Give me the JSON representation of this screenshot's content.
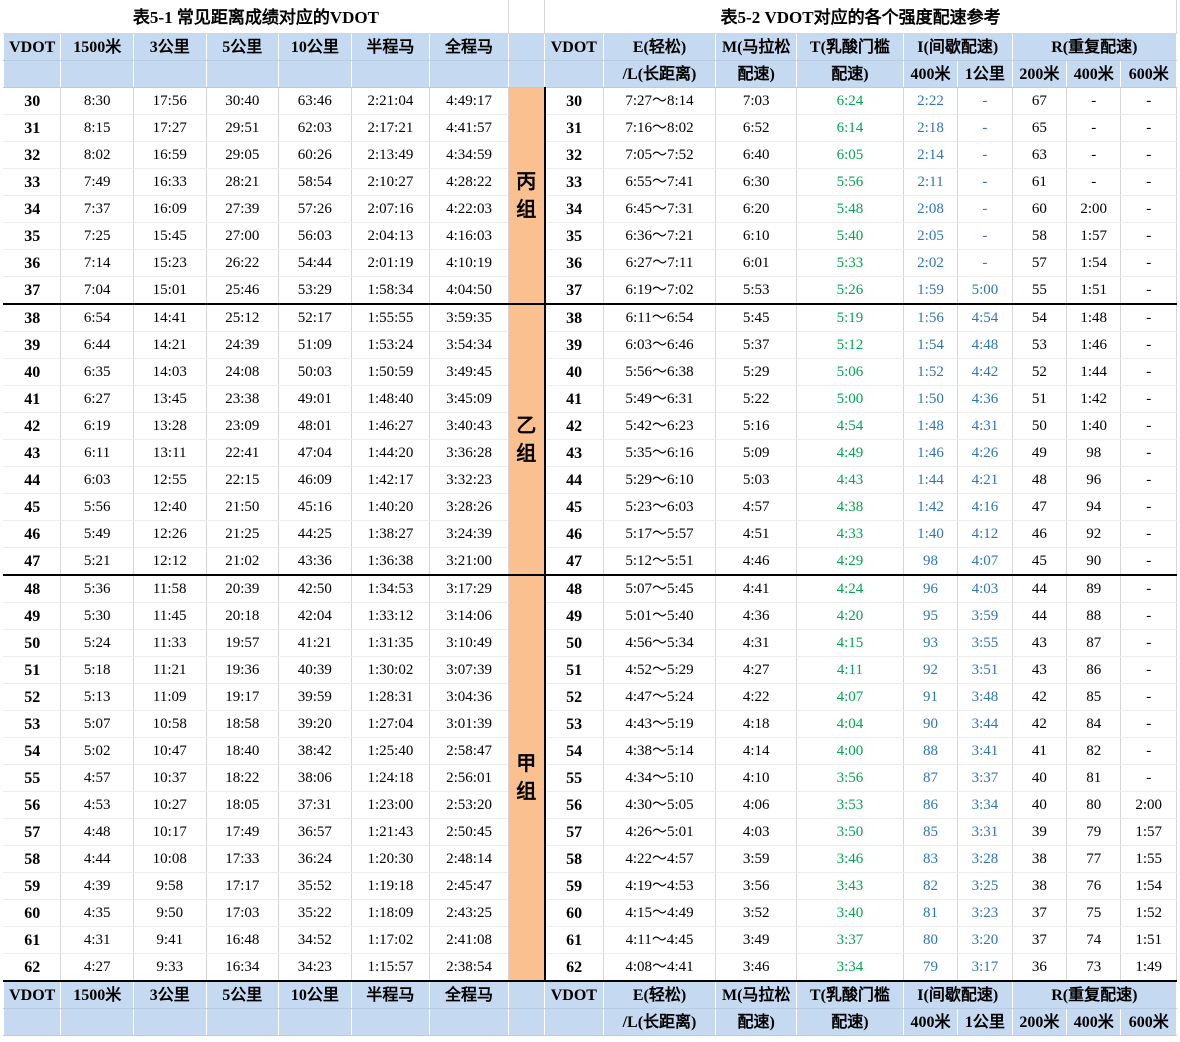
{
  "titles": {
    "left": "表5-1  常见距离成绩对应的VDOT",
    "right": "表5-2  VDOT对应的各个强度配速参考"
  },
  "headers": {
    "left": [
      "VDOT",
      "1500米",
      "3公里",
      "5公里",
      "10公里",
      "半程马",
      "全程马"
    ],
    "right_top": [
      "VDOT",
      "E(轻松)",
      "M(马拉松",
      "T(乳酸门槛",
      "I(间歇配速)",
      "R(重复配速)"
    ],
    "right_bottom": [
      "/L(长距离)",
      "配速)",
      "配速)",
      "400米",
      "1公里",
      "200米",
      "400米",
      "600米"
    ]
  },
  "groups": [
    {
      "label": "丙组",
      "rows": 8
    },
    {
      "label": "乙组",
      "rows": 10
    },
    {
      "label": "甲组",
      "rows": 15
    }
  ],
  "rows": [
    [
      "30",
      "8:30",
      "17:56",
      "30:40",
      "63:46",
      "2:21:04",
      "4:49:17",
      "30",
      "7:27～8:14",
      "7:03",
      "6:24",
      "2:22",
      "-",
      "67",
      "-",
      "-"
    ],
    [
      "31",
      "8:15",
      "17:27",
      "29:51",
      "62:03",
      "2:17:21",
      "4:41:57",
      "31",
      "7:16～8:02",
      "6:52",
      "6:14",
      "2:18",
      "-",
      "65",
      "-",
      "-"
    ],
    [
      "32",
      "8:02",
      "16:59",
      "29:05",
      "60:26",
      "2:13:49",
      "4:34:59",
      "32",
      "7:05～7:52",
      "6:40",
      "6:05",
      "2:14",
      "-",
      "63",
      "-",
      "-"
    ],
    [
      "33",
      "7:49",
      "16:33",
      "28:21",
      "58:54",
      "2:10:27",
      "4:28:22",
      "33",
      "6:55～7:41",
      "6:30",
      "5:56",
      "2:11",
      "-",
      "61",
      "-",
      "-"
    ],
    [
      "34",
      "7:37",
      "16:09",
      "27:39",
      "57:26",
      "2:07:16",
      "4:22:03",
      "34",
      "6:45～7:31",
      "6:20",
      "5:48",
      "2:08",
      "-",
      "60",
      "2:00",
      "-"
    ],
    [
      "35",
      "7:25",
      "15:45",
      "27:00",
      "56:03",
      "2:04:13",
      "4:16:03",
      "35",
      "6:36～7:21",
      "6:10",
      "5:40",
      "2:05",
      "-",
      "58",
      "1:57",
      "-"
    ],
    [
      "36",
      "7:14",
      "15:23",
      "26:22",
      "54:44",
      "2:01:19",
      "4:10:19",
      "36",
      "6:27～7:11",
      "6:01",
      "5:33",
      "2:02",
      "-",
      "57",
      "1:54",
      "-"
    ],
    [
      "37",
      "7:04",
      "15:01",
      "25:46",
      "53:29",
      "1:58:34",
      "4:04:50",
      "37",
      "6:19～7:02",
      "5:53",
      "5:26",
      "1:59",
      "5:00",
      "55",
      "1:51",
      "-"
    ],
    [
      "38",
      "6:54",
      "14:41",
      "25:12",
      "52:17",
      "1:55:55",
      "3:59:35",
      "38",
      "6:11～6:54",
      "5:45",
      "5:19",
      "1:56",
      "4:54",
      "54",
      "1:48",
      "-"
    ],
    [
      "39",
      "6:44",
      "14:21",
      "24:39",
      "51:09",
      "1:53:24",
      "3:54:34",
      "39",
      "6:03～6:46",
      "5:37",
      "5:12",
      "1:54",
      "4:48",
      "53",
      "1:46",
      "-"
    ],
    [
      "40",
      "6:35",
      "14:03",
      "24:08",
      "50:03",
      "1:50:59",
      "3:49:45",
      "40",
      "5:56～6:38",
      "5:29",
      "5:06",
      "1:52",
      "4:42",
      "52",
      "1:44",
      "-"
    ],
    [
      "41",
      "6:27",
      "13:45",
      "23:38",
      "49:01",
      "1:48:40",
      "3:45:09",
      "41",
      "5:49～6:31",
      "5:22",
      "5:00",
      "1:50",
      "4:36",
      "51",
      "1:42",
      "-"
    ],
    [
      "42",
      "6:19",
      "13:28",
      "23:09",
      "48:01",
      "1:46:27",
      "3:40:43",
      "42",
      "5:42～6:23",
      "5:16",
      "4:54",
      "1:48",
      "4:31",
      "50",
      "1:40",
      "-"
    ],
    [
      "43",
      "6:11",
      "13:11",
      "22:41",
      "47:04",
      "1:44:20",
      "3:36:28",
      "43",
      "5:35～6:16",
      "5:09",
      "4:49",
      "1:46",
      "4:26",
      "49",
      "98",
      "-"
    ],
    [
      "44",
      "6:03",
      "12:55",
      "22:15",
      "46:09",
      "1:42:17",
      "3:32:23",
      "44",
      "5:29～6:10",
      "5:03",
      "4:43",
      "1:44",
      "4:21",
      "48",
      "96",
      "-"
    ],
    [
      "45",
      "5:56",
      "12:40",
      "21:50",
      "45:16",
      "1:40:20",
      "3:28:26",
      "45",
      "5:23～6:03",
      "4:57",
      "4:38",
      "1:42",
      "4:16",
      "47",
      "94",
      "-"
    ],
    [
      "46",
      "5:49",
      "12:26",
      "21:25",
      "44:25",
      "1:38:27",
      "3:24:39",
      "46",
      "5:17～5:57",
      "4:51",
      "4:33",
      "1:40",
      "4:12",
      "46",
      "92",
      "-"
    ],
    [
      "47",
      "5:21",
      "12:12",
      "21:02",
      "43:36",
      "1:36:38",
      "3:21:00",
      "47",
      "5:12～5:51",
      "4:46",
      "4:29",
      "98",
      "4:07",
      "45",
      "90",
      "-"
    ],
    [
      "48",
      "5:36",
      "11:58",
      "20:39",
      "42:50",
      "1:34:53",
      "3:17:29",
      "48",
      "5:07～5:45",
      "4:41",
      "4:24",
      "96",
      "4:03",
      "44",
      "89",
      "-"
    ],
    [
      "49",
      "5:30",
      "11:45",
      "20:18",
      "42:04",
      "1:33:12",
      "3:14:06",
      "49",
      "5:01～5:40",
      "4:36",
      "4:20",
      "95",
      "3:59",
      "44",
      "88",
      "-"
    ],
    [
      "50",
      "5:24",
      "11:33",
      "19:57",
      "41:21",
      "1:31:35",
      "3:10:49",
      "50",
      "4:56～5:34",
      "4:31",
      "4:15",
      "93",
      "3:55",
      "43",
      "87",
      "-"
    ],
    [
      "51",
      "5:18",
      "11:21",
      "19:36",
      "40:39",
      "1:30:02",
      "3:07:39",
      "51",
      "4:52～5:29",
      "4:27",
      "4:11",
      "92",
      "3:51",
      "43",
      "86",
      "-"
    ],
    [
      "52",
      "5:13",
      "11:09",
      "19:17",
      "39:59",
      "1:28:31",
      "3:04:36",
      "52",
      "4:47～5:24",
      "4:22",
      "4:07",
      "91",
      "3:48",
      "42",
      "85",
      "-"
    ],
    [
      "53",
      "5:07",
      "10:58",
      "18:58",
      "39:20",
      "1:27:04",
      "3:01:39",
      "53",
      "4:43～5:19",
      "4:18",
      "4:04",
      "90",
      "3:44",
      "42",
      "84",
      "-"
    ],
    [
      "54",
      "5:02",
      "10:47",
      "18:40",
      "38:42",
      "1:25:40",
      "2:58:47",
      "54",
      "4:38～5:14",
      "4:14",
      "4:00",
      "88",
      "3:41",
      "41",
      "82",
      "-"
    ],
    [
      "55",
      "4:57",
      "10:37",
      "18:22",
      "38:06",
      "1:24:18",
      "2:56:01",
      "55",
      "4:34～5:10",
      "4:10",
      "3:56",
      "87",
      "3:37",
      "40",
      "81",
      "-"
    ],
    [
      "56",
      "4:53",
      "10:27",
      "18:05",
      "37:31",
      "1:23:00",
      "2:53:20",
      "56",
      "4:30～5:05",
      "4:06",
      "3:53",
      "86",
      "3:34",
      "40",
      "80",
      "2:00"
    ],
    [
      "57",
      "4:48",
      "10:17",
      "17:49",
      "36:57",
      "1:21:43",
      "2:50:45",
      "57",
      "4:26～5:01",
      "4:03",
      "3:50",
      "85",
      "3:31",
      "39",
      "79",
      "1:57"
    ],
    [
      "58",
      "4:44",
      "10:08",
      "17:33",
      "36:24",
      "1:20:30",
      "2:48:14",
      "58",
      "4:22～4:57",
      "3:59",
      "3:46",
      "83",
      "3:28",
      "38",
      "77",
      "1:55"
    ],
    [
      "59",
      "4:39",
      "9:58",
      "17:17",
      "35:52",
      "1:19:18",
      "2:45:47",
      "59",
      "4:19～4:53",
      "3:56",
      "3:43",
      "82",
      "3:25",
      "38",
      "76",
      "1:54"
    ],
    [
      "60",
      "4:35",
      "9:50",
      "17:03",
      "35:22",
      "1:18:09",
      "2:43:25",
      "60",
      "4:15～4:49",
      "3:52",
      "3:40",
      "81",
      "3:23",
      "37",
      "75",
      "1:52"
    ],
    [
      "61",
      "4:31",
      "9:41",
      "16:48",
      "34:52",
      "1:17:02",
      "2:41:08",
      "61",
      "4:11～4:45",
      "3:49",
      "3:37",
      "80",
      "3:20",
      "37",
      "74",
      "1:51"
    ],
    [
      "62",
      "4:27",
      "9:33",
      "16:34",
      "34:23",
      "1:15:57",
      "2:38:54",
      "62",
      "4:08～4:41",
      "3:46",
      "3:34",
      "79",
      "3:17",
      "36",
      "73",
      "1:49"
    ]
  ],
  "colors": {
    "header_bg": "#c5d9f1",
    "group_bg": "#fac090",
    "t_pace_text": "#00a650",
    "i_pace_text": "#2e75b6"
  }
}
